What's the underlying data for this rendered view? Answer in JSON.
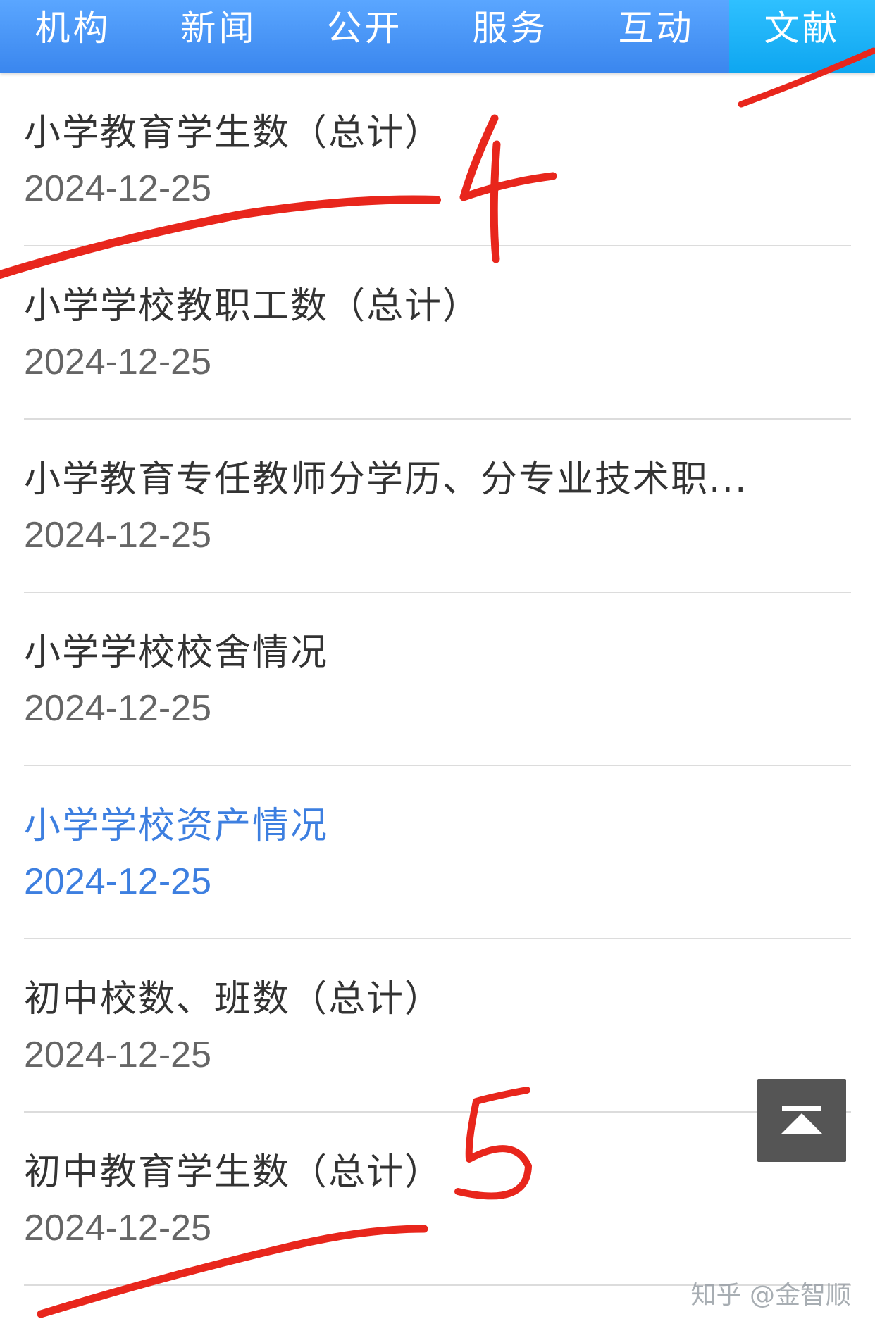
{
  "nav": {
    "tabs": [
      {
        "label": "机构"
      },
      {
        "label": "新闻"
      },
      {
        "label": "公开"
      },
      {
        "label": "服务"
      },
      {
        "label": "互动"
      },
      {
        "label": "文献"
      }
    ],
    "active_tab": "文献"
  },
  "list": {
    "items": [
      {
        "title": "小学教育学生数（总计）",
        "date": "2024-12-25"
      },
      {
        "title": "小学学校教职工数（总计）",
        "date": "2024-12-25"
      },
      {
        "title": "小学教育专任教师分学历、分专业技术职...",
        "date": "2024-12-25"
      },
      {
        "title": "小学学校校舍情况",
        "date": "2024-12-25"
      },
      {
        "title": "小学学校资产情况",
        "date": "2024-12-25",
        "selected": true
      },
      {
        "title": "初中校数、班数（总计）",
        "date": "2024-12-25"
      },
      {
        "title": "初中教育学生数（总计）",
        "date": "2024-12-25"
      }
    ]
  },
  "back_to_top": {
    "icon": "back-to-top-icon"
  },
  "annotations": {
    "marks": [
      "4",
      "5"
    ],
    "color": "#e8261c"
  },
  "watermark": {
    "text": "知乎 @金智顺"
  },
  "colors": {
    "nav": "#3a86ee",
    "active_tab": "#0ea6f0",
    "selected_text": "#3d7fe0"
  }
}
